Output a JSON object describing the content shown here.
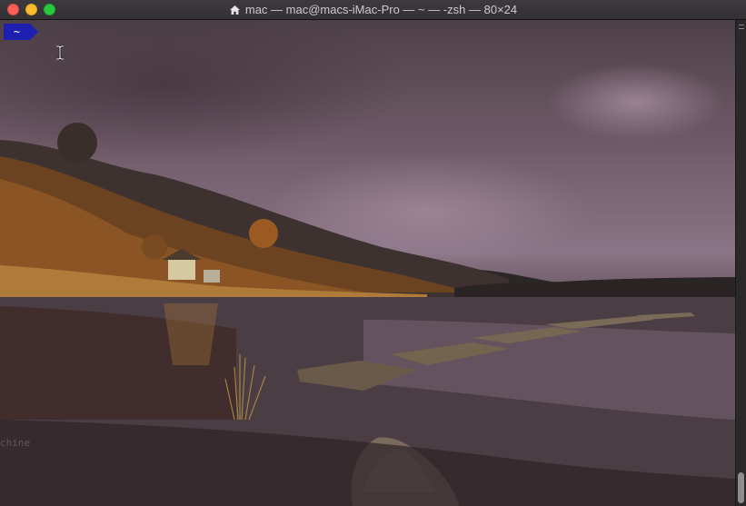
{
  "window": {
    "title": "mac — mac@macs-iMac-Pro — ~ — -zsh — 80×24",
    "title_icon": "home-icon",
    "controls": [
      "close",
      "minimize",
      "zoom"
    ]
  },
  "terminal": {
    "prompt_dir": "~",
    "faint_text": "chine",
    "background": "landscape-lake-wallpaper",
    "prompt_color": "#1d1fb0"
  },
  "scrollbar": {
    "position": 1
  }
}
